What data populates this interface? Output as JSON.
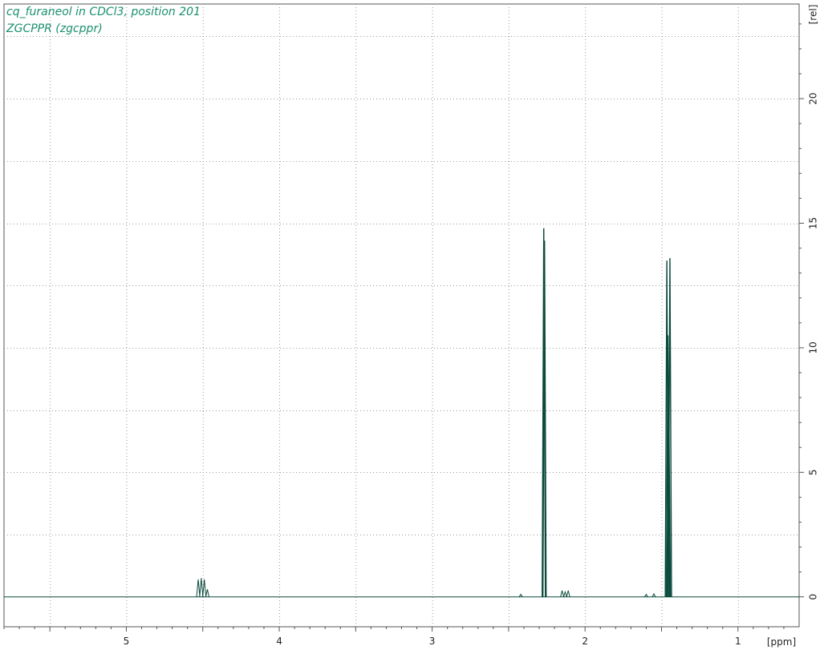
{
  "header": {
    "title_line1": "cq_furaneol in CDCl3, position 201",
    "title_line2": "ZGCPPR (zgcppr)"
  },
  "colors": {
    "spectrum": "#0a4a3c",
    "title": "#1b8f6e",
    "grid": "#9a9a9a",
    "frame": "#555555"
  },
  "chart_data": {
    "type": "line",
    "title": "cq_furaneol in CDCl3, position 201",
    "subtitle": "ZGCPPR (zgcppr)",
    "xlabel": "[ppm]",
    "ylabel": "[rel]",
    "xlim": [
      5.8,
      0.6
    ],
    "ylim": [
      -1.2,
      23.8
    ],
    "x_ticks": [
      5,
      4,
      3,
      2,
      1
    ],
    "x_tick_labels": [
      "5",
      "4",
      "3",
      "2",
      "1"
    ],
    "y_ticks": [
      0,
      5,
      10,
      15,
      20
    ],
    "y_tick_labels": [
      "0",
      "5",
      "10",
      "15",
      "20"
    ],
    "grid": true,
    "x_reversed": true,
    "peaks": [
      {
        "x": 4.53,
        "y": 0.7
      },
      {
        "x": 4.51,
        "y": 0.75
      },
      {
        "x": 4.49,
        "y": 0.7
      },
      {
        "x": 4.47,
        "y": 0.3
      },
      {
        "x": 2.42,
        "y": 0.1
      },
      {
        "x": 2.27,
        "y": 14.8
      },
      {
        "x": 2.265,
        "y": 14.3
      },
      {
        "x": 2.15,
        "y": 0.25
      },
      {
        "x": 2.13,
        "y": 0.2
      },
      {
        "x": 2.11,
        "y": 0.25
      },
      {
        "x": 1.465,
        "y": 13.5
      },
      {
        "x": 1.458,
        "y": 10.5
      },
      {
        "x": 1.452,
        "y": 7.3
      },
      {
        "x": 1.445,
        "y": 13.6
      },
      {
        "x": 1.6,
        "y": 0.1
      },
      {
        "x": 1.55,
        "y": 0.12
      }
    ]
  }
}
